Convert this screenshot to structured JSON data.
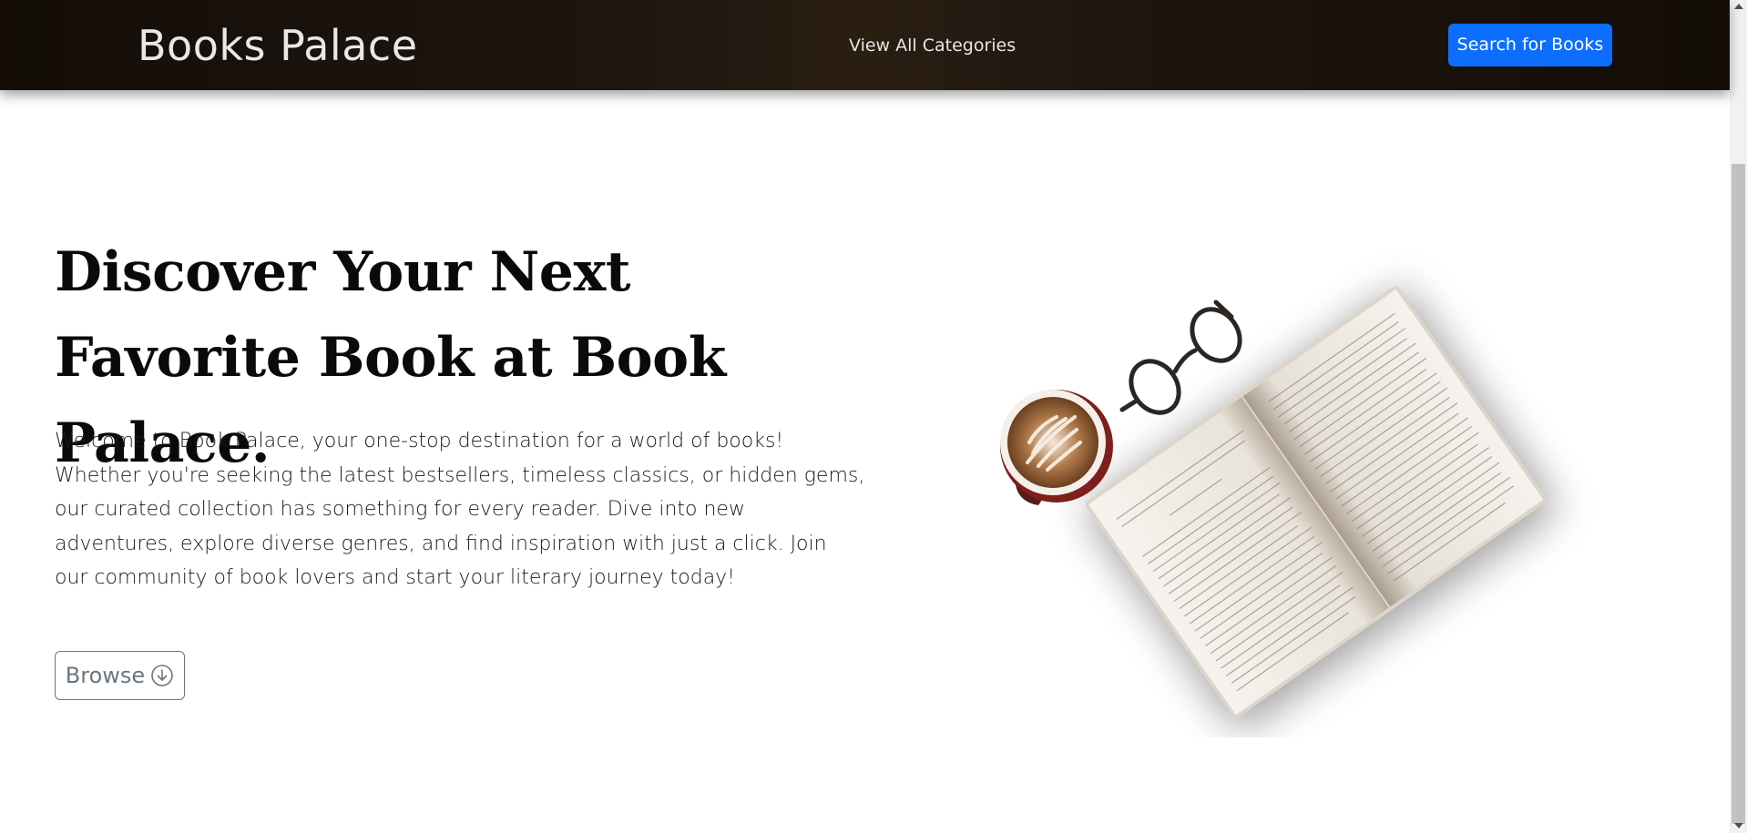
{
  "header": {
    "brand": "Books Palace",
    "nav_link": "View All Categories",
    "search_button": "Search for Books"
  },
  "hero": {
    "title": "Discover Your Next Favorite Book at Book Palace.",
    "description": "Welcome to Book Palace, your one-stop destination for a world of books! Whether you're seeking the latest bestsellers, timeless classics, or hidden gems, our curated collection has something for every reader. Dive into new adventures, explore diverse genres, and find inspiration with just a click. Join our community of book lovers and start your literary journey today!",
    "browse_button": "Browse",
    "browse_icon": "arrow-down-circle-icon",
    "illustration": "open-book-coffee-glasses-image"
  },
  "colors": {
    "navbar_bg": "#1a120b",
    "primary": "#0d6efd",
    "secondary": "#6c757d"
  }
}
